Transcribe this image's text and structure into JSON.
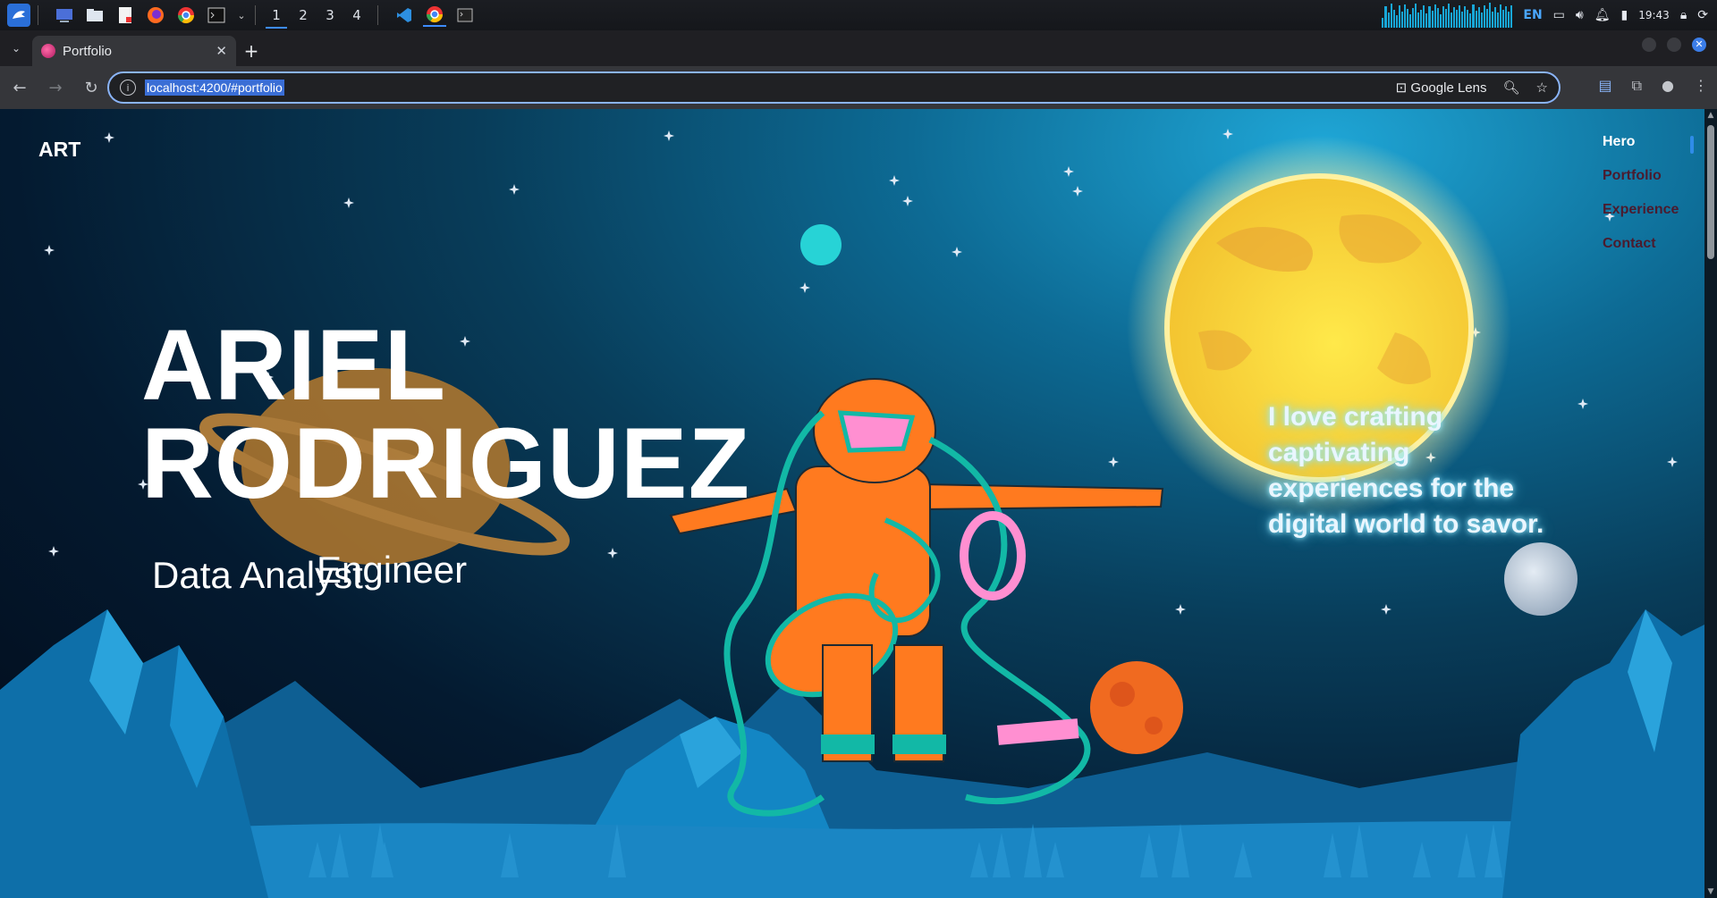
{
  "taskbar": {
    "workspaces": [
      "1",
      "2",
      "3",
      "4"
    ],
    "active_workspace": "1",
    "language": "EN",
    "clock": "19:43"
  },
  "browser": {
    "tab_title": "Portfolio",
    "url": "localhost:4200/#portfolio",
    "lens_label": "Google Lens"
  },
  "page": {
    "logo": "ART",
    "nav": [
      {
        "label": "Hero",
        "active": true
      },
      {
        "label": "Portfolio",
        "active": false
      },
      {
        "label": "Experience",
        "active": false
      },
      {
        "label": "Contact",
        "active": false
      }
    ],
    "name_line1": "ARIEL",
    "name_line2": "RODRIGUEZ",
    "role_primary": "Data Analyst",
    "role_secondary": "Engineer",
    "tagline": "I love crafting captivating experiences for the digital world to savor."
  },
  "colors": {
    "accent": "#3d8cff",
    "nav_dim": "#4b1b2e",
    "sun": "#f7d23a",
    "astronaut_suit": "#ff7a1f",
    "tubes": "#12b8a6",
    "mountains": "#0f79b6"
  }
}
